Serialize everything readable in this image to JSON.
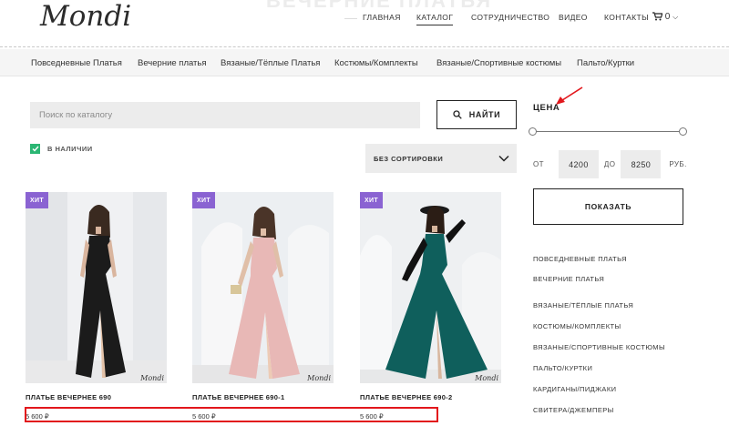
{
  "header": {
    "hero_title": "ВЕЧЕРНИЕ ПЛАТЬЯ",
    "logo": "Mondi",
    "nav": [
      "ГЛАВНАЯ",
      "КАТАЛОГ",
      "СОТРУДНИЧЕСТВО",
      "ВИДЕО",
      "КОНТАКТЫ"
    ],
    "nav_active": "КАТАЛОГ",
    "cart_count": "0",
    "cart_icon": "cart-icon"
  },
  "category_bar": [
    "Повседневные Платья",
    "Вечерние платья",
    "Вязаные/Тёплые Платья",
    "Костюмы/Комплекты",
    "Вязаные/Спортивные костюмы",
    "Пальто/Куртки"
  ],
  "search": {
    "placeholder": "Поиск по каталогу",
    "button_label": "НАЙТИ"
  },
  "filter": {
    "in_stock_label": "В НАЛИЧИИ",
    "in_stock_checked": true,
    "sort_label": "БЕЗ СОРТИРОВКИ"
  },
  "products": [
    {
      "badge": "ХИТ",
      "name": "ПЛАТЬЕ ВЕЧЕРНЕЕ 690",
      "price": "5 600 ₽",
      "dress_color": "#1b1b1b",
      "bg_color": "#f0f1f3",
      "watermark": "Mondi"
    },
    {
      "badge": "ХИТ",
      "name": "ПЛАТЬЕ ВЕЧЕРНЕЕ 690-1",
      "price": "5 600 ₽",
      "dress_color": "#e8b8b6",
      "bg_color": "#eceff2",
      "watermark": "Mondi"
    },
    {
      "badge": "ХИТ",
      "name": "ПЛАТЬЕ ВЕЧЕРНЕЕ 690-2",
      "price": "5 600 ₽",
      "dress_color": "#0f5f5c",
      "bg_color": "#eef0f2",
      "watermark": "Mondi"
    }
  ],
  "sidebar": {
    "price_title": "ЦЕНА",
    "from_label": "ОТ",
    "min_value": "4200",
    "to_label": "ДО",
    "max_value": "8250",
    "currency": "РУБ.",
    "show_button": "ПОКАЗАТЬ",
    "links": [
      "ПОВСЕДНЕВНЫЕ ПЛАТЬЯ",
      "ВЕЧЕРНИЕ ПЛАТЬЯ",
      "ВЯЗАНЫЕ/ТЁПЛЫЕ ПЛАТЬЯ",
      "КОСТЮМЫ/КОМПЛЕКТЫ",
      "ВЯЗАНЫЕ/СПОРТИВНЫЕ КОСТЮМЫ",
      "ПАЛЬТО/КУРТКИ",
      "КАРДИГАНЫ/ПИДЖАКИ",
      "СВИТЕРА/ДЖЕМПЕРЫ"
    ]
  },
  "annotations": {
    "highlight_color": "#e2171c"
  }
}
